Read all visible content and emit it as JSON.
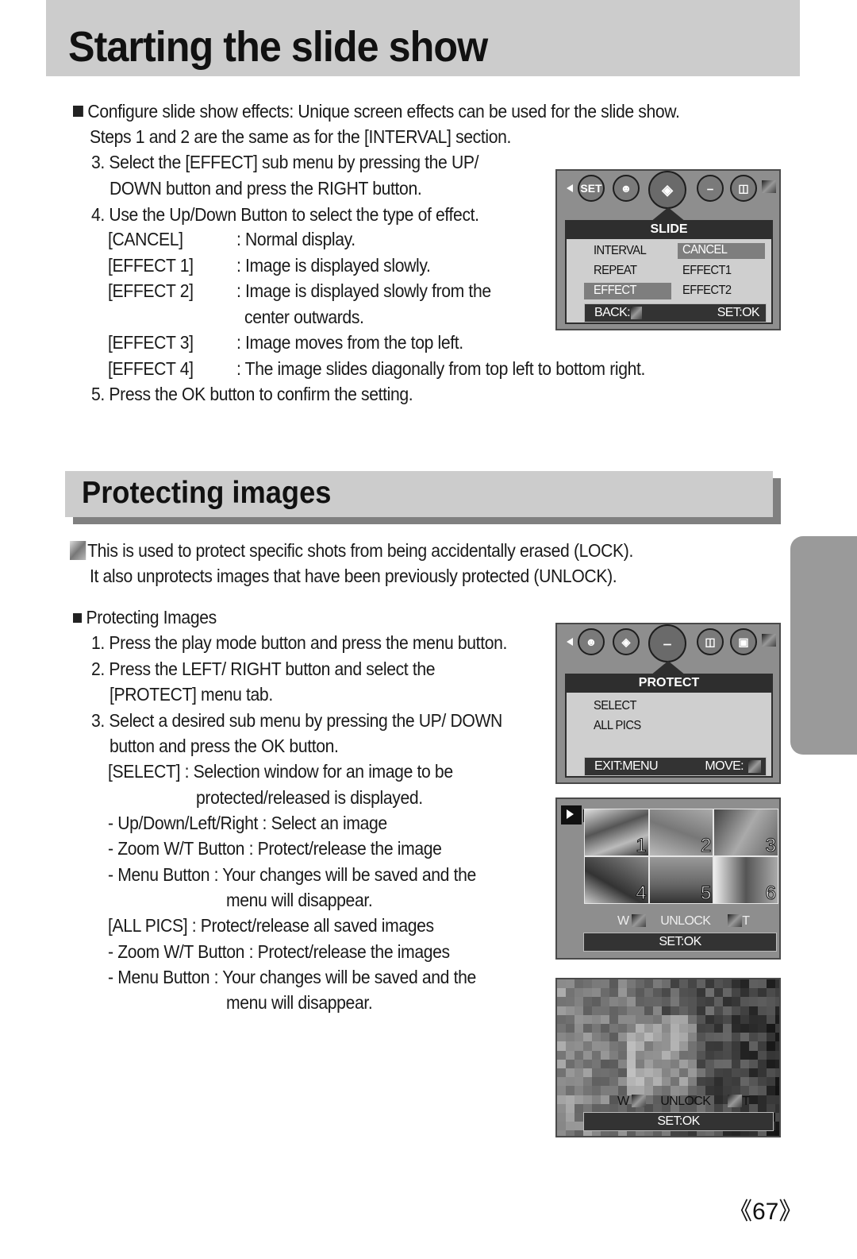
{
  "section1": {
    "title": "Starting the slide show",
    "intro_line1": "Configure slide show effects: Unique screen effects can be used for the slide show.",
    "intro_line2": "Steps 1 and 2 are the same as for the [INTERVAL] section.",
    "step3_line1": "3. Select the [EFFECT] sub menu by pressing the UP/",
    "step3_line2": "DOWN button and press the RIGHT button.",
    "step4": "4. Use the Up/Down Button to select the type of effect.",
    "effects": [
      {
        "key": "[CANCEL]",
        "desc": ": Normal display."
      },
      {
        "key": "[EFFECT 1]",
        "desc": ": Image is displayed slowly."
      },
      {
        "key": "[EFFECT 2]",
        "desc": ": Image is displayed slowly from the",
        "desc2": "center outwards."
      },
      {
        "key": "[EFFECT 3]",
        "desc": ": Image moves from the top left."
      },
      {
        "key": "[EFFECT 4]",
        "desc": ": The image slides diagonally from top left to bottom right."
      }
    ],
    "step5": "5. Press the OK button to confirm the setting."
  },
  "slide_screen": {
    "icons": [
      "set-icon",
      "person-camera-icon",
      "slide-icon",
      "key-icon",
      "trash-icon"
    ],
    "set_label": "SET",
    "header": "SLIDE",
    "left_items": [
      "INTERVAL",
      "REPEAT",
      "EFFECT"
    ],
    "right_items": [
      "CANCEL",
      "EFFECT1",
      "EFFECT2"
    ],
    "selected_left": "EFFECT",
    "selected_right": "CANCEL",
    "footer_left": "BACK:",
    "footer_right": "SET:OK"
  },
  "section2": {
    "title": "Protecting images",
    "intro_line1": "This is used to protect specific shots from being accidentally erased (LOCK).",
    "intro_line2": "It also unprotects images that have been previously protected (UNLOCK).",
    "subhead": "Protecting Images",
    "lines": [
      "1. Press the play mode button and press the menu button.",
      "2. Press the LEFT/ RIGHT button and select the",
      "[PROTECT] menu tab.",
      "3. Select a desired sub menu by pressing the UP/ DOWN",
      "button and press the OK button.",
      "[SELECT] : Selection window for an image to be",
      "protected/released is displayed.",
      "- Up/Down/Left/Right : Select an image",
      "- Zoom W/T Button : Protect/release the image",
      "- Menu Button : Your changes will be saved and the",
      "menu will disappear.",
      "[ALL PICS] : Protect/release all saved images",
      "- Zoom W/T Button : Protect/release the images",
      "- Menu Button : Your changes will be saved and the",
      "menu will disappear."
    ]
  },
  "protect_screen": {
    "icons": [
      "person-camera-icon",
      "slide-icon",
      "key-icon",
      "trash-icon",
      "resize-icon"
    ],
    "header": "PROTECT",
    "items": [
      "SELECT",
      "ALL PICS"
    ],
    "footer_left": "EXIT:MENU",
    "footer_right": "MOVE:"
  },
  "thumb_screen": {
    "numbers": [
      "1",
      "2",
      "3",
      "4",
      "5",
      "6"
    ],
    "w_label": "W",
    "status": "UNLOCK",
    "t_label": "T",
    "footer": "SET:OK"
  },
  "single_screen": {
    "w_label": "W",
    "status": "UNLOCK",
    "t_label": "T",
    "footer": "SET:OK"
  },
  "page_number": "《67》"
}
